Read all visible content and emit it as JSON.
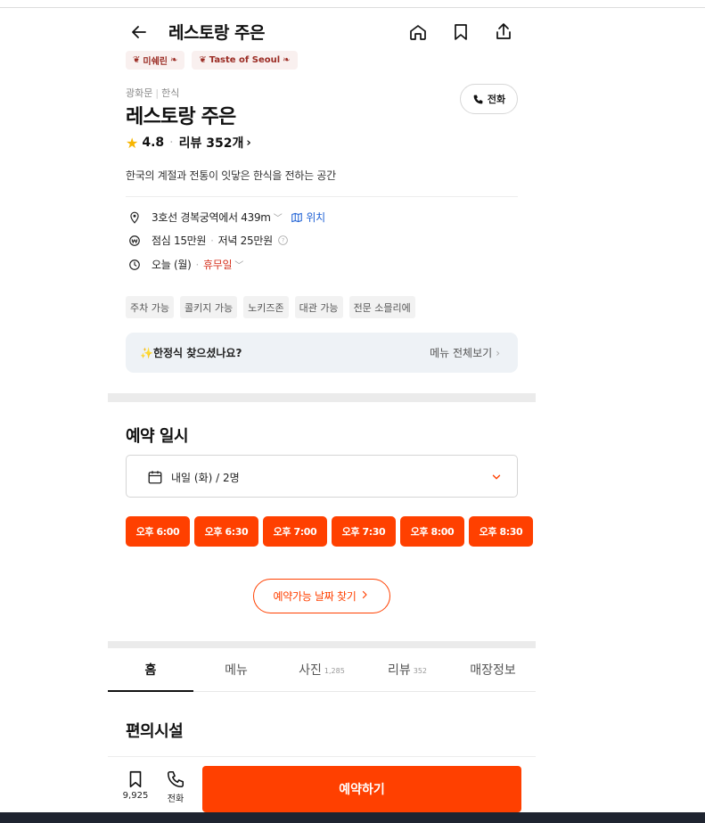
{
  "header": {
    "title": "레스토랑 주은"
  },
  "badges": [
    {
      "label": "미쉐린"
    },
    {
      "label": "Taste of Seoul"
    }
  ],
  "restaurant": {
    "location": "광화문",
    "cuisine": "한식",
    "name": "레스토랑 주은",
    "rating": "4.8",
    "reviews_label": "리뷰 352개",
    "description": "한국의 계절과 전통이 잇닿은 한식을 전하는 공간"
  },
  "call_button": {
    "label": "전화"
  },
  "info": {
    "address": "3호선 경복궁역에서 439m",
    "map_label": "위치",
    "lunch_price": "점심 15만원",
    "dinner_price": "저녁 25만원",
    "today": "오늘 (월)",
    "status": "휴무일"
  },
  "tags": [
    "주차 가능",
    "콜키지 가능",
    "노키즈존",
    "대관 가능",
    "전문 소믈리에"
  ],
  "banner": {
    "question": "✨한정식 찾으셨나요?",
    "link": "메뉴 전체보기"
  },
  "reservation": {
    "title": "예약 일시",
    "selected": "내일 (화) / 2명",
    "slots": [
      "오후 6:00",
      "오후 6:30",
      "오후 7:00",
      "오후 7:30",
      "오후 8:00",
      "오후 8:30"
    ],
    "find_label": "예약가능 날짜 찾기"
  },
  "tabs": [
    {
      "label": "홈",
      "count": ""
    },
    {
      "label": "메뉴",
      "count": ""
    },
    {
      "label": "사진",
      "count": "1,285"
    },
    {
      "label": "리뷰",
      "count": "352"
    },
    {
      "label": "매장정보",
      "count": ""
    }
  ],
  "section": {
    "title": "편의시설"
  },
  "bottom_bar": {
    "save_count": "9,925",
    "call_label": "전화",
    "book_label": "예약하기"
  },
  "colors": {
    "accent": "#ff4000",
    "status_red": "#d6331f",
    "link_blue": "#2062d5",
    "star": "#f7b500"
  }
}
